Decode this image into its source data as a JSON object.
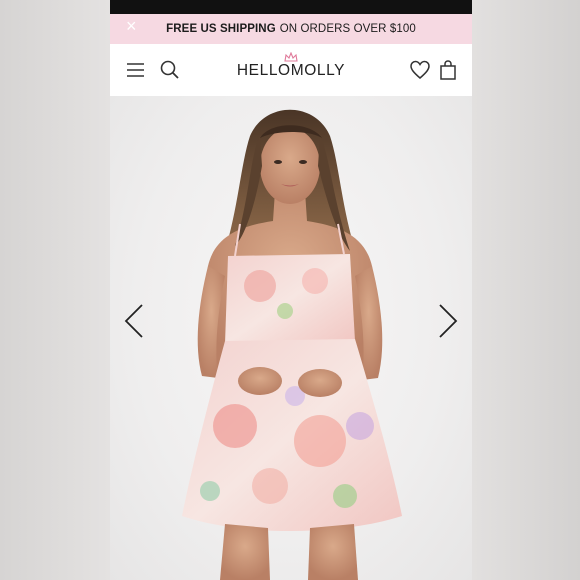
{
  "promo_bar": {
    "bold_text": "FREE US SHIPPING",
    "regular_text": "ON ORDERS OVER $100"
  },
  "header": {
    "logo_text": "HELLOMOLLY",
    "menu_icon": "hamburger-icon",
    "search_icon": "search-icon",
    "wishlist_icon": "heart-icon",
    "bag_icon": "shopping-bag-icon"
  },
  "product_gallery": {
    "image_alt": "Model wearing pastel floral satin mini dress",
    "prev_icon": "chevron-left-icon",
    "next_icon": "chevron-right-icon"
  },
  "colors": {
    "promo_bg": "#f6d9e2",
    "logo_crown": "#e07a9a"
  }
}
